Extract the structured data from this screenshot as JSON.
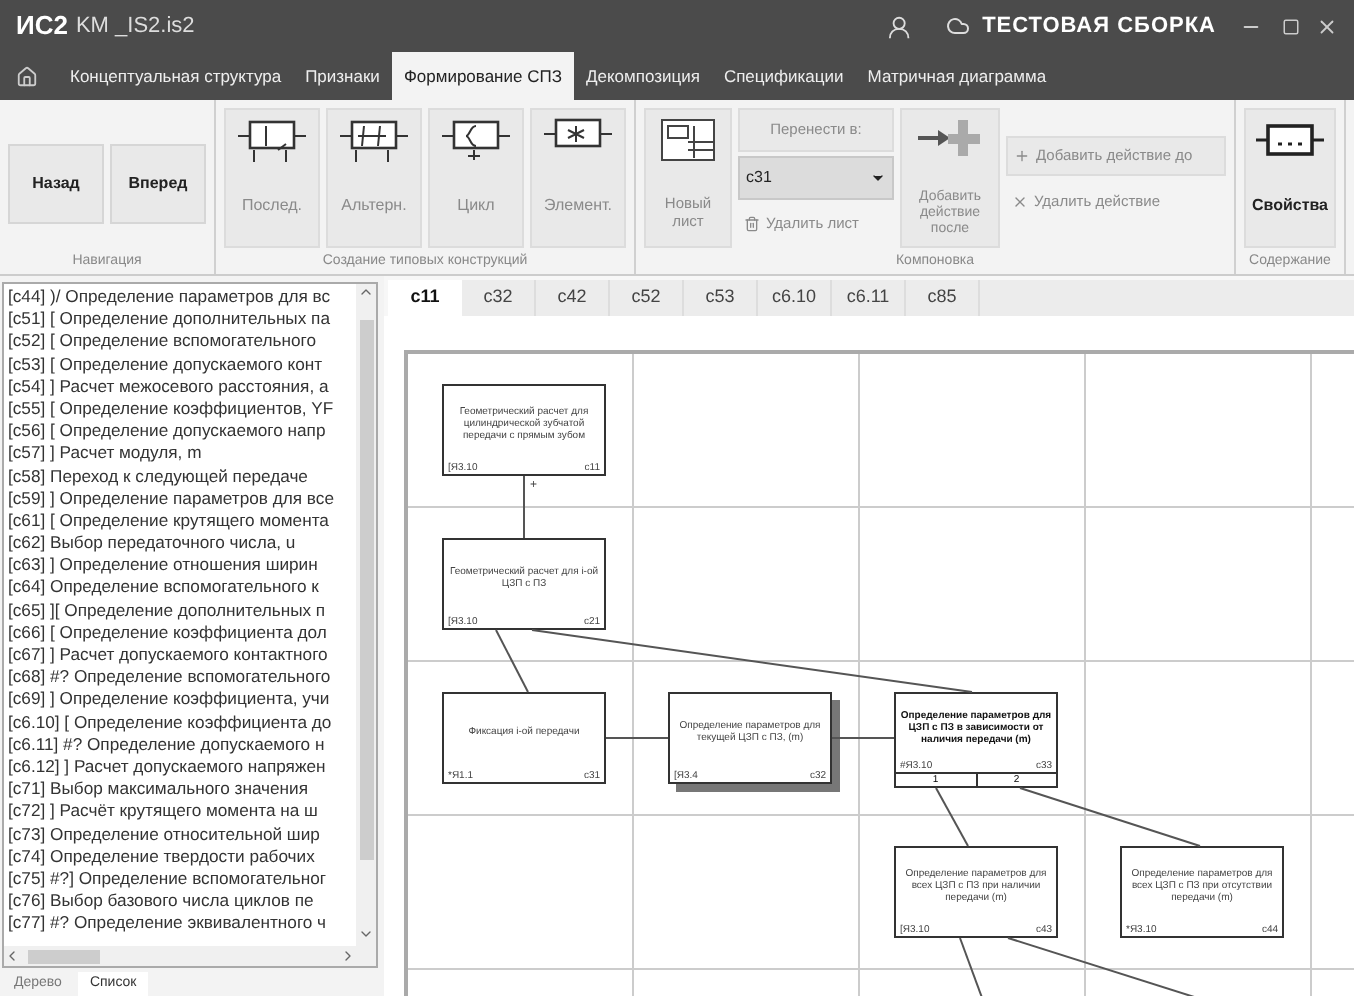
{
  "title_bar": {
    "app": "ИС2",
    "file": "KM _IS2.is2",
    "build": "ТЕСТОВАЯ СБОРКА"
  },
  "menu_tabs": [
    {
      "label": "Концептуальная структура",
      "selected": false
    },
    {
      "label": "Признаки",
      "selected": false
    },
    {
      "label": "Формирование СПЗ",
      "selected": true
    },
    {
      "label": "Декомпозиция",
      "selected": false
    },
    {
      "label": "Спецификации",
      "selected": false
    },
    {
      "label": "Матричная диаграмма",
      "selected": false
    }
  ],
  "ribbon": [
    {
      "label": "Навигация",
      "items": [
        {
          "kind": "text",
          "label": "Назад",
          "disabled": false
        },
        {
          "kind": "text",
          "label": "Вперед",
          "disabled": false
        }
      ]
    },
    {
      "label": "Создание типовых конструкций",
      "items": [
        {
          "kind": "sequence",
          "label": "Послед.",
          "disabled": true
        },
        {
          "kind": "alternative",
          "label": "Альтерн.",
          "disabled": true
        },
        {
          "kind": "loop",
          "label": "Цикл",
          "disabled": true
        },
        {
          "kind": "element",
          "label": "Элемент.",
          "disabled": true
        }
      ]
    },
    {
      "label": "Компоновка",
      "items": [
        {
          "kind": "new_sheet",
          "label": "Новый лист",
          "disabled": true
        },
        {
          "kind": "move",
          "label": "Перенести в:",
          "value": "c31",
          "delete_label": "Удалить лист",
          "disabled": true
        },
        {
          "kind": "add_after",
          "label": "Добавить действие после",
          "disabled": true
        },
        {
          "kind": "small_pair",
          "first": "Добавить действие до",
          "second": "Удалить действие",
          "disabled": true
        }
      ]
    },
    {
      "label": "Содержание",
      "items": [
        {
          "kind": "properties",
          "label": "Свойства",
          "disabled": false
        }
      ]
    }
  ],
  "list": [
    "[c44] )/ Определение параметров для вс",
    "[c51] [ Определение дополнительных па",
    "[c52] [ Определение вспомогательного",
    "[c53] [ Определение допускаемого конт",
    "[c54] ] Расчет межосевого расстояния, а",
    "[c55] [ Определение коэффициентов, YF",
    "[c56] [ Определение допускаемого напр",
    "[c57] ] Расчет модуля, m",
    "[c58]  Переход к следующей передаче",
    "[c59] ] Определение параметров для все",
    "[c61] [ Определение крутящего момента",
    "[c62]  Выбор передаточного числа, u",
    "[c63] ] Определение отношения ширин",
    "[c64]  Определение вспомогательного к",
    "[c65] ][ Определение дополнительных п",
    "[c66] [ Определение коэффициента дол",
    "[c67] ] Расчет допускаемого контактного",
    "[c68] #? Определение вспомогательного",
    "[c69] ] Определение коэффициента, учи",
    "[c6.10] [ Определение коэффициента до",
    "[c6.11] #? Определение допускаемого н",
    "[c6.12] ] Расчет допускаемого напряжен",
    "[c71]  Выбор максимального значения",
    "[c72] ] Расчёт крутящего момента на ш",
    "[c73]  Определение относительной шир",
    "[c74]  Определение твердости рабочих",
    "[c75] #?] Определение вспомогательног",
    "[c76]  Выбор базового числа циклов пе",
    "[c77] #? Определение эквивалентного ч"
  ],
  "panel_tabs": [
    {
      "label": "Дерево",
      "selected": false
    },
    {
      "label": "Список",
      "selected": true
    }
  ],
  "sheet_tabs": [
    {
      "label": "c11",
      "selected": true
    },
    {
      "label": "c32",
      "selected": false
    },
    {
      "label": "c42",
      "selected": false
    },
    {
      "label": "c52",
      "selected": false
    },
    {
      "label": "c53",
      "selected": false
    },
    {
      "label": "c6.10",
      "selected": false
    },
    {
      "label": "c6.11",
      "selected": false
    },
    {
      "label": "c85",
      "selected": false
    }
  ],
  "diagram": {
    "rows": [
      {
        "cells": [
          {
            "title": "Геометрический расчет для цилиндрической зубчатой передачи с прямым зубом",
            "code": "[Я3.10",
            "id": "c11",
            "emphasized": false,
            "shadow": false,
            "link_label": "+"
          },
          null,
          null,
          null,
          null
        ]
      },
      {
        "cells": [
          {
            "title": "Геометрический расчет для i-ой ЦЗП с ПЗ",
            "code": "[Я3.10",
            "id": "c21",
            "emphasized": false,
            "shadow": false
          },
          null,
          null,
          null,
          null
        ]
      },
      {
        "cells": [
          {
            "title": "Фиксация i-ой передачи",
            "code": "*Я1.1",
            "id": "c31",
            "emphasized": false,
            "shadow": false
          },
          {
            "title": "Определение параметров для текущей ЦЗП с ПЗ, (m)",
            "code": "[Я3.4",
            "id": "c32",
            "emphasized": false,
            "shadow": true
          },
          {
            "title": "Определение параметров для ЦЗП с ПЗ в зависимости от наличия передачи (m)",
            "code": "#Я3.10",
            "id": "c33",
            "emphasized": true,
            "shadow": false,
            "ports": [
              "1",
              "2"
            ]
          },
          null,
          null
        ]
      },
      {
        "cells": [
          null,
          null,
          {
            "title": "Определение параметров для всех ЦЗП с ПЗ при наличии передачи (m)",
            "code": "[Я3.10",
            "id": "c43",
            "emphasized": false,
            "shadow": false
          },
          {
            "title": "Определение параметров для всех ЦЗП с ПЗ при отсутствии передачи (m)",
            "code": "*Я3.10",
            "id": "c44",
            "emphasized": false,
            "shadow": false
          },
          null
        ]
      },
      {
        "cells": [
          null,
          null,
          null,
          null,
          null
        ]
      }
    ]
  }
}
